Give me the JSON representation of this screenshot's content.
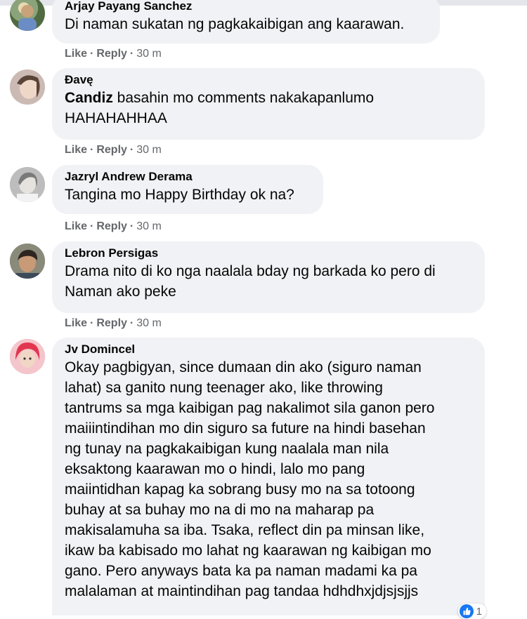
{
  "comments": [
    {
      "author": "Arjay Payang Sanchez",
      "mention": "",
      "lines": [
        "Di naman sukatan ng pagkakaibigan ang kaarawan."
      ],
      "time": "30 m"
    },
    {
      "author": "Đavę",
      "mention": "Candiz",
      "lines": [
        " basahin mo comments nakakapanlumo",
        "HAHAHAHHAA"
      ],
      "time": "30 m"
    },
    {
      "author": "Jazryl Andrew Derama",
      "mention": "",
      "lines": [
        "Tangina mo Happy Birthday ok na?"
      ],
      "time": "30 m"
    },
    {
      "author": "Lebron Persigas",
      "mention": "",
      "lines": [
        "Drama nito di ko nga naalala bday ng barkada ko pero di",
        "Naman ako peke"
      ],
      "time": "30 m"
    },
    {
      "author": "Jv Domincel",
      "mention": "",
      "lines": [
        "Okay pagbigyan, since dumaan din ako (siguro naman",
        "lahat) sa ganito nung teenager ako, like throwing",
        "tantrums sa mga kaibigan pag nakalimot sila ganon pero",
        "maiiintindihan mo din siguro sa future na hindi basehan",
        "ng tunay na pagkakaibigan kung naalala man nila",
        "eksaktong kaarawan mo o hindi, lalo mo pang",
        "maiintidhan kapag ka sobrang busy mo na sa totoong",
        "buhay at sa buhay mo na di mo na maharap pa",
        "makisalamuha sa iba. Tsaka, reflect din pa minsan like,",
        "ikaw ba kabisado mo lahat ng kaarawan ng kaibigan mo",
        "gano. Pero anyways bata ka pa naman madami ka pa",
        "malalaman at maintindihan pag tandaa hdhdhxjdjsjsjjs"
      ],
      "time": "",
      "reaction_count": "1"
    }
  ],
  "actions": {
    "like_label": "Like",
    "reply_label": "Reply",
    "separator": "·"
  },
  "colors": {
    "bubble": "#f0f2f5",
    "text": "#050505",
    "meta": "#65676b",
    "like_blue": "#1877f2"
  },
  "icons": {
    "reaction": "like-icon",
    "avatar": "avatar"
  }
}
